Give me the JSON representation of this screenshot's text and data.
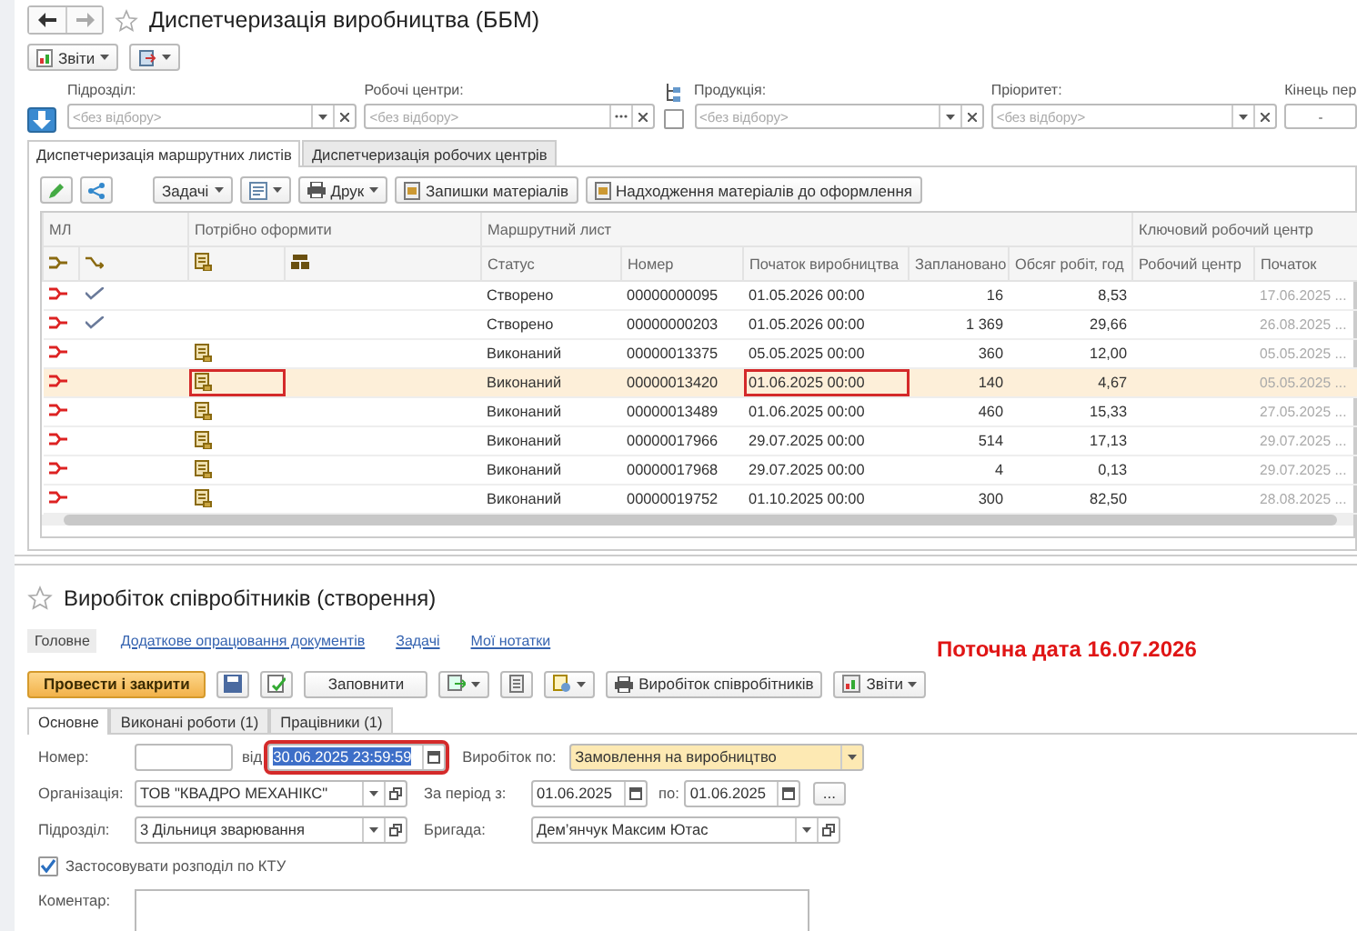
{
  "window": {
    "title": "Диспетчеризація виробництва (ББМ)",
    "reports_button": "Звіти"
  },
  "filters": [
    {
      "label": "Підрозділ:",
      "placeholder": "<без відбору>",
      "kind": "select"
    },
    {
      "label": "Робочі центри:",
      "placeholder": "<без відбору>",
      "kind": "choice"
    },
    {
      "label": "Продукція:",
      "placeholder": "<без відбору>",
      "kind": "select"
    },
    {
      "label": "Пріоритет:",
      "placeholder": "<без відбору>",
      "kind": "select"
    },
    {
      "label": "Кінець пер",
      "value": "-",
      "kind": "period"
    }
  ],
  "hierarchy_checkbox": {
    "checked": false
  },
  "tabs": [
    {
      "label": "Диспетчеризація маршрутних листів",
      "selected": true
    },
    {
      "label": "Диспетчеризація робочих центрів",
      "selected": false
    }
  ],
  "toolbar": {
    "tasks_button": "Задачі",
    "print_button": "Друк",
    "buttons": [
      "Запишки матеріалів",
      "Надходження матеріалів до оформлення"
    ]
  },
  "table": {
    "groups": [
      {
        "label": "МЛ",
        "columns": [
          {
            "kind": "route_icon"
          },
          {
            "kind": "arrow_icon"
          }
        ]
      },
      {
        "label": "Потрібно оформити",
        "columns": [
          {
            "kind": "doc_icon"
          },
          {
            "kind": "boxes_icon"
          }
        ]
      },
      {
        "label": "Маршрутний лист",
        "columns": [
          {
            "kind": "text",
            "label": "Статус"
          },
          {
            "kind": "text",
            "label": "Номер"
          },
          {
            "kind": "text",
            "label": "Початок виробництва"
          },
          {
            "kind": "text",
            "label": "Заплановано"
          },
          {
            "kind": "text",
            "label": "Обсяг робіт, год"
          }
        ]
      },
      {
        "label": "Ключовий робочий центр",
        "columns": [
          {
            "kind": "text",
            "label": "Робочий центр"
          },
          {
            "kind": "text",
            "label": "Початок"
          }
        ]
      }
    ],
    "rows": [
      {
        "confirmed": true,
        "needs_documents": false,
        "selected": false,
        "outlined": false,
        "status": "Створено",
        "number": "00000000095",
        "start": "01.05.2026 00:00",
        "planned": "16",
        "volume": "8,53",
        "wc_start": "17.06.2025 ..."
      },
      {
        "confirmed": true,
        "needs_documents": false,
        "selected": false,
        "outlined": false,
        "status": "Створено",
        "number": "00000000203",
        "start": "01.05.2026 00:00",
        "planned": "1 369",
        "volume": "29,66",
        "wc_start": "26.08.2025 ..."
      },
      {
        "confirmed": false,
        "needs_documents": true,
        "selected": false,
        "outlined": false,
        "status": "Виконаний",
        "number": "00000013375",
        "start": "05.05.2025 00:00",
        "planned": "360",
        "volume": "12,00",
        "wc_start": "05.05.2025 ..."
      },
      {
        "confirmed": false,
        "needs_documents": true,
        "selected": true,
        "outlined": true,
        "status": "Виконаний",
        "number": "00000013420",
        "start": "01.06.2025 00:00",
        "planned": "140",
        "volume": "4,67",
        "wc_start": "05.05.2025 ..."
      },
      {
        "confirmed": false,
        "needs_documents": true,
        "selected": false,
        "outlined": false,
        "status": "Виконаний",
        "number": "00000013489",
        "start": "01.06.2025 00:00",
        "planned": "460",
        "volume": "15,33",
        "wc_start": "27.05.2025 ..."
      },
      {
        "confirmed": false,
        "needs_documents": true,
        "selected": false,
        "outlined": false,
        "status": "Виконаний",
        "number": "00000017966",
        "start": "29.07.2025 00:00",
        "planned": "514",
        "volume": "17,13",
        "wc_start": "29.07.2025 ..."
      },
      {
        "confirmed": false,
        "needs_documents": true,
        "selected": false,
        "outlined": false,
        "status": "Виконаний",
        "number": "00000017968",
        "start": "29.07.2025 00:00",
        "planned": "4",
        "volume": "0,13",
        "wc_start": "29.07.2025 ..."
      },
      {
        "confirmed": false,
        "needs_documents": true,
        "selected": false,
        "outlined": false,
        "status": "Виконаний",
        "number": "00000019752",
        "start": "01.10.2025 00:00",
        "planned": "300",
        "volume": "82,50",
        "wc_start": "28.08.2025 ..."
      }
    ]
  },
  "form": {
    "title": "Виробіток співробітників (створення)",
    "sections": [
      {
        "label": "Головне",
        "selected": true
      },
      {
        "label": "Додаткове опрацювання документів",
        "selected": false
      },
      {
        "label": "Задачі",
        "selected": false
      },
      {
        "label": "Мої нотатки",
        "selected": false
      }
    ],
    "toolbar": {
      "post_button": "Провести і закрити",
      "fill_button": "Заповнити",
      "print_button": "Виробіток співробітників",
      "reports_button": "Звіти"
    },
    "notice": "Поточна дата 16.07.2026",
    "tabs": [
      {
        "label": "Основне",
        "selected": true
      },
      {
        "label": "Виконані роботи (1)",
        "selected": false
      },
      {
        "label": "Працівники (1)",
        "selected": false
      }
    ],
    "number": {
      "label": "Номер:"
    },
    "date": {
      "label": "від",
      "value": "30.06.2025 23:59:59",
      "outlined": true,
      "text_selected": true
    },
    "basis": {
      "label": "Виробіток по:",
      "value": "Замовлення на виробництво"
    },
    "organization": {
      "label": "Організація:",
      "value": "ТОВ \"КВАДРО МЕХАНІКС\""
    },
    "period": {
      "label": "За період з:",
      "from": "01.06.2025",
      "to_label": "по:",
      "to": "01.06.2025",
      "more_button": "..."
    },
    "department": {
      "label": "Підрозділ:",
      "value": "3 Дільниця зварювання"
    },
    "brigade": {
      "label": "Бригада:",
      "value": "Дем’янчук Максим Ютас"
    },
    "ktu": {
      "label": "Застосовувати розподіл по КТУ",
      "checked": true
    },
    "comment": {
      "label": "Коментар:"
    }
  }
}
